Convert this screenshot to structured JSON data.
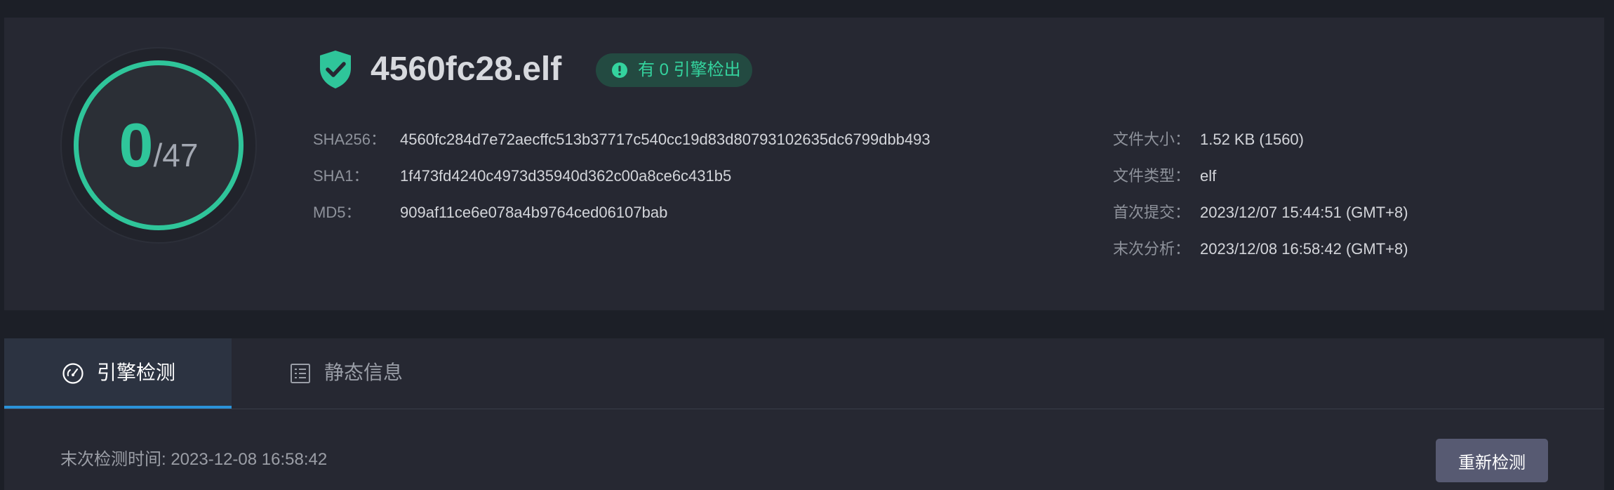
{
  "file": {
    "name": "4560fc28.elf",
    "detection_badge": "有 0 引擎检出"
  },
  "score": {
    "detected": "0",
    "total": "/47"
  },
  "hashes": [
    {
      "label": "SHA256：",
      "value": "4560fc284d7e72aecffc513b37717c540cc19d83d80793102635dc6799dbb493"
    },
    {
      "label": "SHA1：",
      "value": "1f473fd4240c4973d35940d362c00a8ce6c431b5"
    },
    {
      "label": "MD5：",
      "value": "909af11ce6e078a4b9764ced06107bab"
    }
  ],
  "details": [
    {
      "label": "文件大小：",
      "value": "1.52 KB (1560)"
    },
    {
      "label": "文件类型：",
      "value": "elf"
    },
    {
      "label": "首次提交：",
      "value": "2023/12/07 15:44:51 (GMT+8)"
    },
    {
      "label": "末次分析：",
      "value": "2023/12/08 16:58:42 (GMT+8)"
    }
  ],
  "tabs": [
    {
      "label": "引擎检测",
      "icon": "gauge-icon",
      "active": true
    },
    {
      "label": "静态信息",
      "icon": "document-list-icon",
      "active": false
    }
  ],
  "scan": {
    "last_scan": "末次检测时间: 2023-12-08 16:58:42",
    "rescan_label": "重新检测"
  },
  "colors": {
    "accent_green": "#2fc59a",
    "tab_underline": "#2b93d9",
    "card_background": "#262832",
    "page_background": "#1c1f27"
  }
}
